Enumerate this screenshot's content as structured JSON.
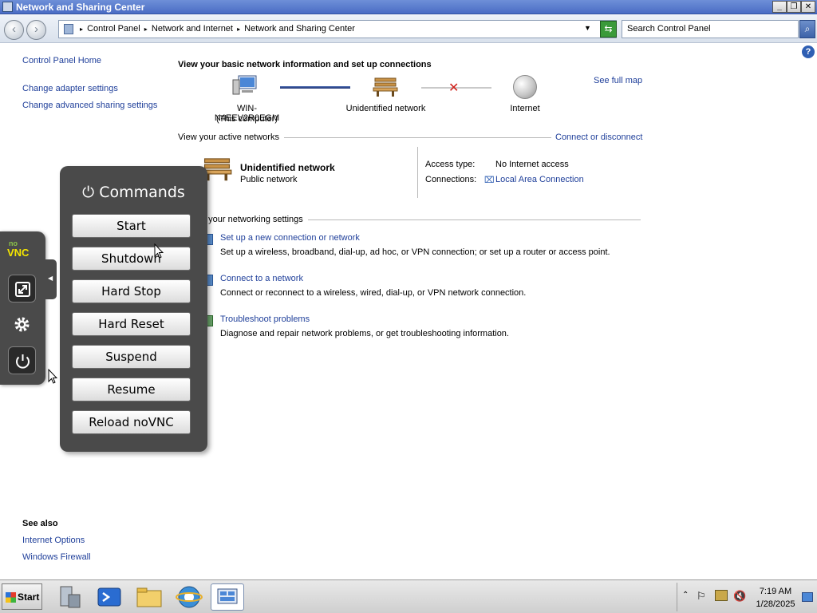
{
  "window": {
    "title": "Network and Sharing Center"
  },
  "addressbar": {
    "breadcrumbs": [
      "Control Panel",
      "Network and Internet",
      "Network and Sharing Center"
    ],
    "search_placeholder": "Search Control Panel"
  },
  "left_pane": {
    "home": "Control Panel Home",
    "links": [
      "Change adapter settings",
      "Change advanced sharing settings"
    ],
    "see_also_heading": "See also",
    "see_also": [
      "Internet Options",
      "Windows Firewall"
    ]
  },
  "main": {
    "heading": "View your basic network information and set up connections",
    "see_full_map": "See full map",
    "map": {
      "computer_name": "WIN-N4EEV2R0EGM",
      "computer_sub": "(This computer)",
      "network_name": "Unidentified network",
      "internet_label": "Internet"
    },
    "active_networks_label": "View your active networks",
    "connect_link": "Connect or disconnect",
    "active_network": {
      "name": "Unidentified network",
      "type": "Public network"
    },
    "access_type_label": "Access type:",
    "access_type_value": "No Internet access",
    "connections_label": "Connections:",
    "connections_value": "Local Area Connection",
    "change_settings_label": "e your networking settings",
    "tasks": [
      {
        "title": "Set up a new connection or network",
        "desc": "Set up a wireless, broadband, dial-up, ad hoc, or VPN connection; or set up a router or access point."
      },
      {
        "title": "Connect to a network",
        "desc": "Connect or reconnect to a wireless, wired, dial-up, or VPN network connection."
      },
      {
        "title": "Troubleshoot problems",
        "desc": "Diagnose and repair network problems, or get troubleshooting information."
      }
    ]
  },
  "novnc": {
    "logo_top": "no",
    "logo_bottom": "VNC",
    "commands_title": "Commands",
    "buttons": [
      "Start",
      "Shutdown",
      "Hard Stop",
      "Hard Reset",
      "Suspend",
      "Resume",
      "Reload noVNC"
    ]
  },
  "taskbar": {
    "start_label": "Start",
    "clock_time": "7:19 AM",
    "clock_date": "1/28/2025"
  },
  "colors": {
    "link": "#1f3f9a",
    "novnc_panel": "#4a4a4a",
    "title_bar": "#4a6cc4"
  }
}
